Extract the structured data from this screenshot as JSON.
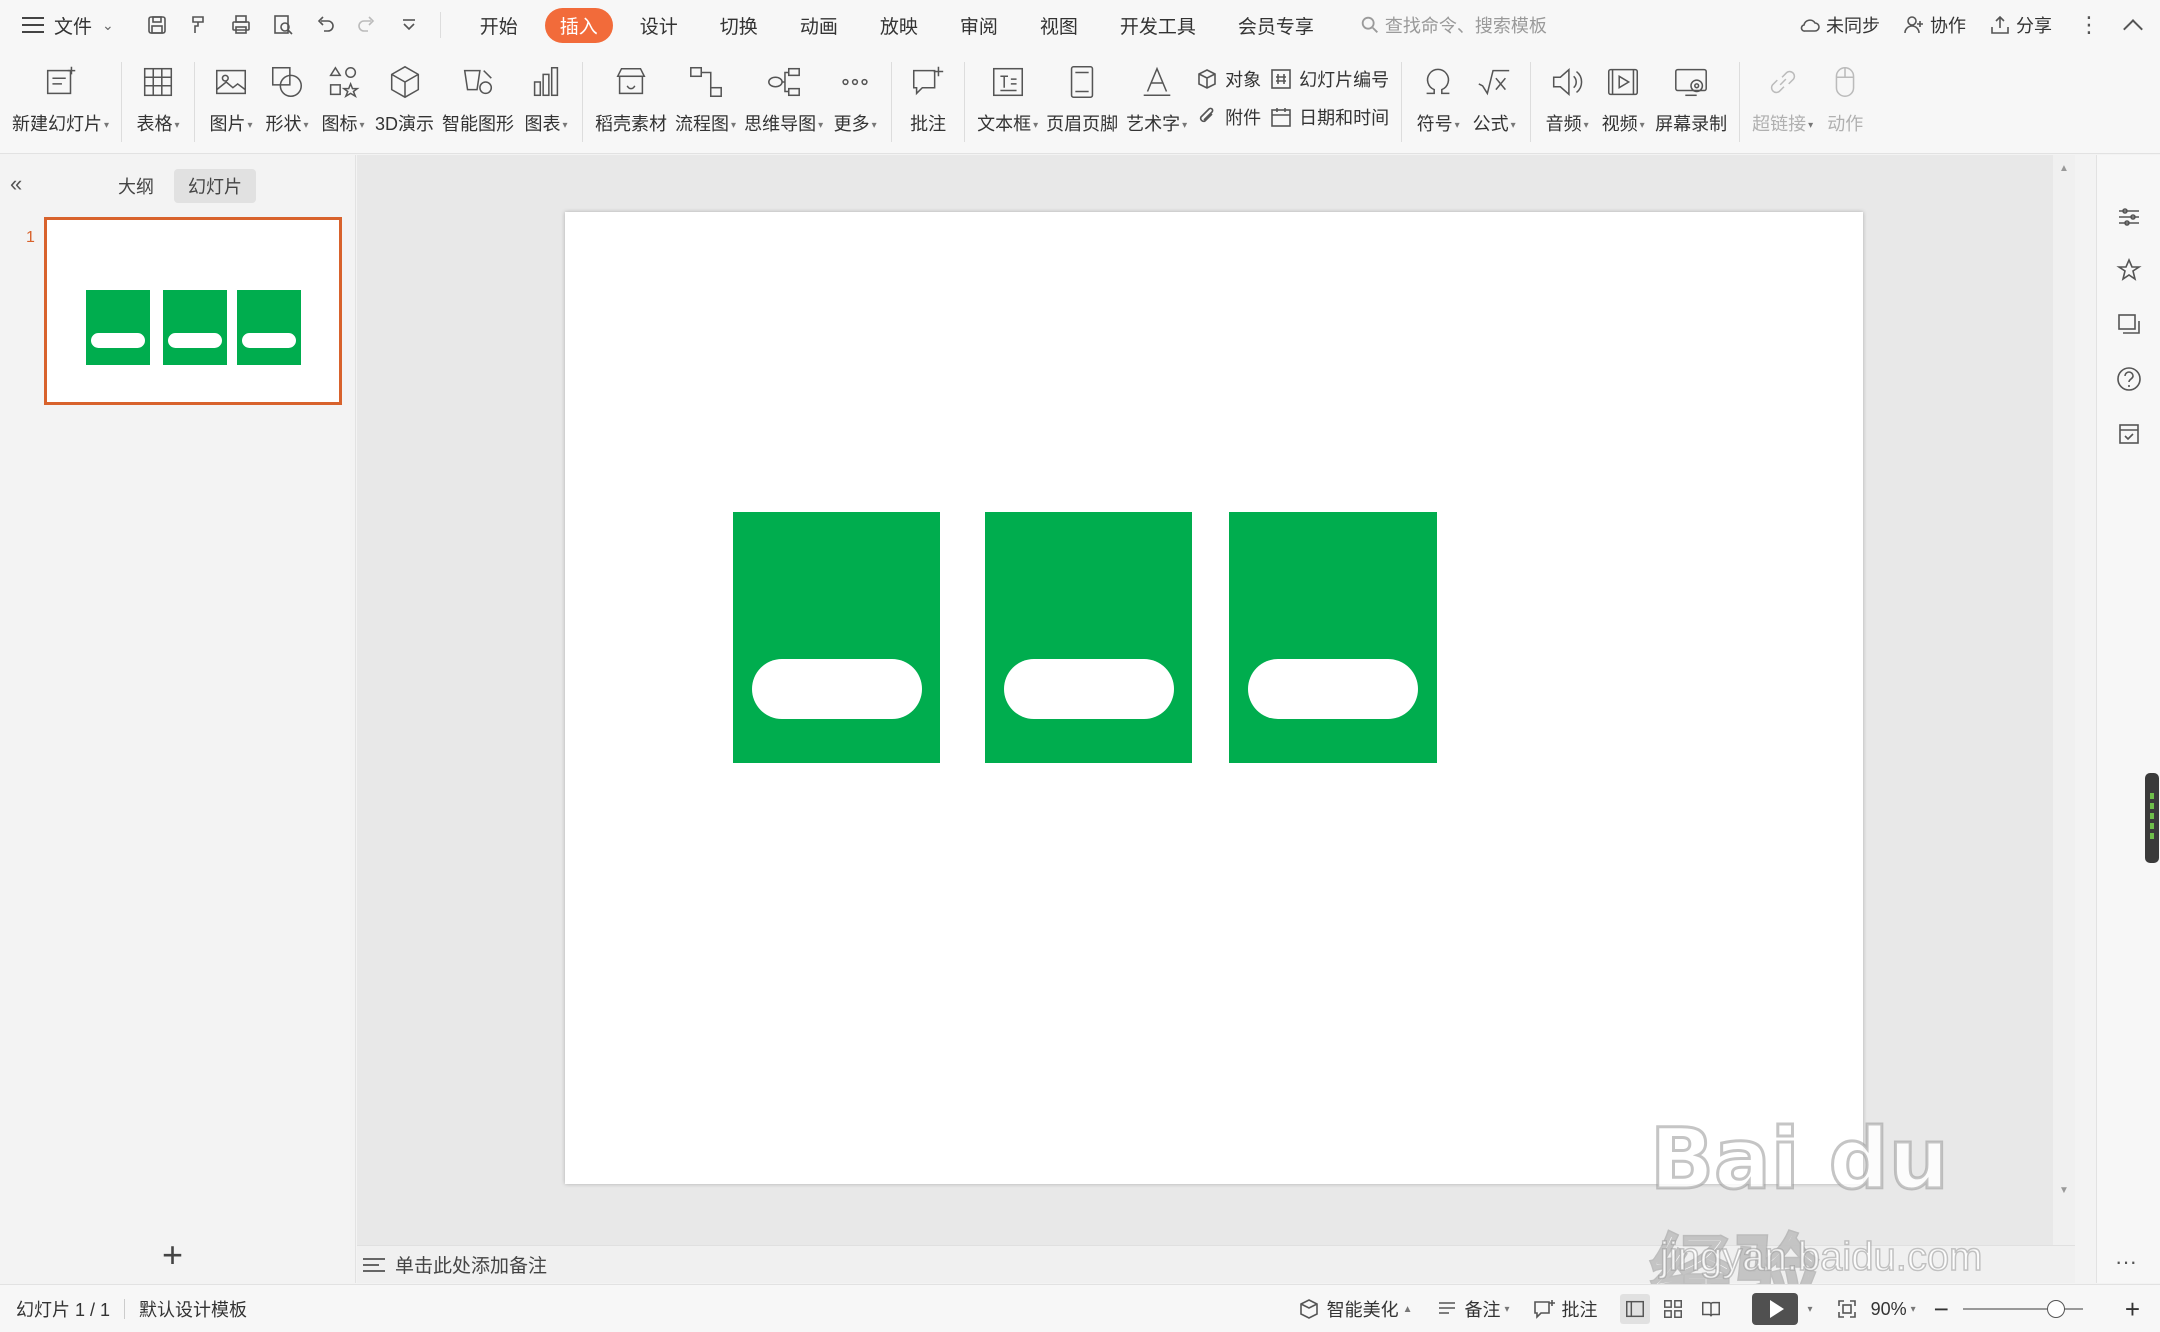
{
  "menubar": {
    "file_label": "文件",
    "tabs": [
      {
        "label": "开始",
        "active": false
      },
      {
        "label": "插入",
        "active": true
      },
      {
        "label": "设计",
        "active": false
      },
      {
        "label": "切换",
        "active": false
      },
      {
        "label": "动画",
        "active": false
      },
      {
        "label": "放映",
        "active": false
      },
      {
        "label": "审阅",
        "active": false
      },
      {
        "label": "视图",
        "active": false
      },
      {
        "label": "开发工具",
        "active": false
      },
      {
        "label": "会员专享",
        "active": false
      }
    ],
    "search_placeholder": "查找命令、搜索模板",
    "sync_label": "未同步",
    "collab_label": "协作",
    "share_label": "分享"
  },
  "ribbon": {
    "new_slide": "新建幻灯片",
    "table": "表格",
    "picture": "图片",
    "shape": "形状",
    "icon": "图标",
    "demo_3d": "3D演示",
    "smart_graphic": "智能图形",
    "chart": "图表",
    "daoke_material": "稻壳素材",
    "flowchart": "流程图",
    "mindmap": "思维导图",
    "more": "更多",
    "comment": "批注",
    "textbox": "文本框",
    "header_footer": "页眉页脚",
    "wordart": "艺术字",
    "object": "对象",
    "slide_number": "幻灯片编号",
    "attachment": "附件",
    "date_time": "日期和时间",
    "symbol": "符号",
    "formula": "公式",
    "audio": "音频",
    "video": "视频",
    "screen_record": "屏幕录制",
    "hyperlink": "超链接",
    "action": "动作"
  },
  "left_panel": {
    "tab_outline": "大纲",
    "tab_slides": "幻灯片",
    "slide_number": "1"
  },
  "slide": {
    "card_color": "#00ad4e",
    "pill_color": "#ffffff",
    "cards": 3
  },
  "notes": {
    "placeholder": "单击此处添加备注"
  },
  "statusbar": {
    "slide_info": "幻灯片 1 / 1",
    "template": "默认设计模板",
    "smart_beautify": "智能美化",
    "notes": "备注",
    "comment": "批注",
    "zoom": "90%"
  },
  "watermark": {
    "logo": "Bai du 经验",
    "url": "jingyan.baidu.com"
  },
  "colors": {
    "accent": "#f26b3a",
    "selection": "#d8622c",
    "green": "#00ad4e"
  }
}
